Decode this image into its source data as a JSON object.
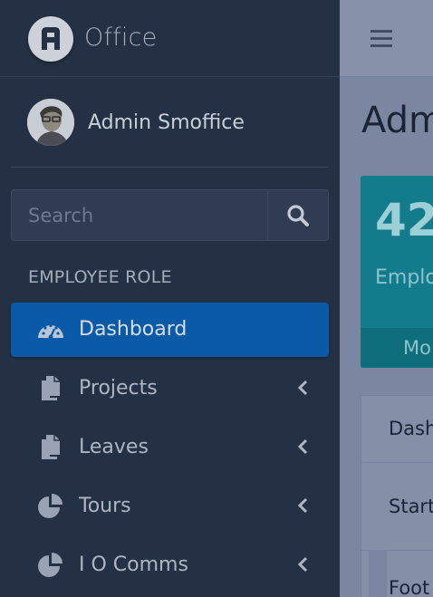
{
  "brand": {
    "name": "Office",
    "logo_letter": "A"
  },
  "user": {
    "name": "Admin Smoffice"
  },
  "search": {
    "placeholder": "Search"
  },
  "sidebar": {
    "section_header": "EMPLOYEE ROLE",
    "items": [
      {
        "label": "Dashboard",
        "icon": "dashboard-gauge-icon",
        "active": true,
        "has_chevron": false
      },
      {
        "label": "Projects",
        "icon": "copy-files-icon",
        "active": false,
        "has_chevron": true
      },
      {
        "label": "Leaves",
        "icon": "copy-files-icon",
        "active": false,
        "has_chevron": true
      },
      {
        "label": "Tours",
        "icon": "pie-chart-icon",
        "active": false,
        "has_chevron": true
      },
      {
        "label": "I O Comms",
        "icon": "pie-chart-icon",
        "active": false,
        "has_chevron": true
      }
    ]
  },
  "main": {
    "page_title": "Adm",
    "stat": {
      "number": "42",
      "label": "Emplo",
      "footer": "Mo"
    },
    "panel_rows": [
      "Dash",
      "Start",
      "Foot"
    ]
  },
  "colors": {
    "sidebar_bg": "#243043",
    "active_item": "#0b5aa8",
    "stat_box": "#127c8c",
    "overlay": "#7b87a0"
  }
}
